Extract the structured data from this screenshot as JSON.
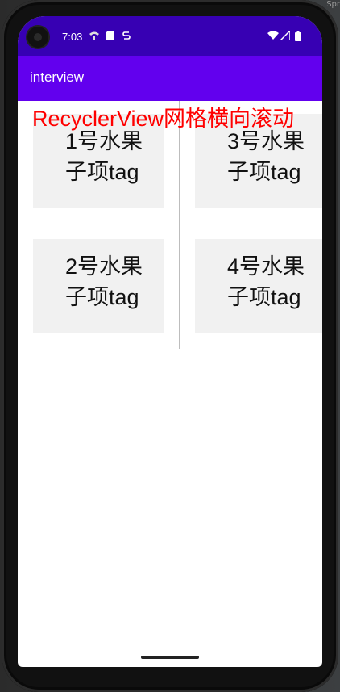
{
  "status_bar": {
    "time": "7:03",
    "left_icons": [
      "wifi-calling-icon",
      "sd-card-icon",
      "s-notification-icon"
    ],
    "right_icons": [
      "wifi-icon",
      "signal-icon",
      "battery-icon"
    ]
  },
  "app_bar": {
    "title": "interview"
  },
  "overlay_title": "RecyclerView网格横向滚动",
  "corner_text": "Spr",
  "grid": {
    "items": [
      {
        "line1": "1号水果",
        "line2": "子项tag"
      },
      {
        "line1": "2号水果",
        "line2": "子项tag"
      },
      {
        "line1": "3号水果",
        "line2": "子项tag"
      },
      {
        "line1": "4号水果",
        "line2": "子项tag"
      }
    ]
  }
}
